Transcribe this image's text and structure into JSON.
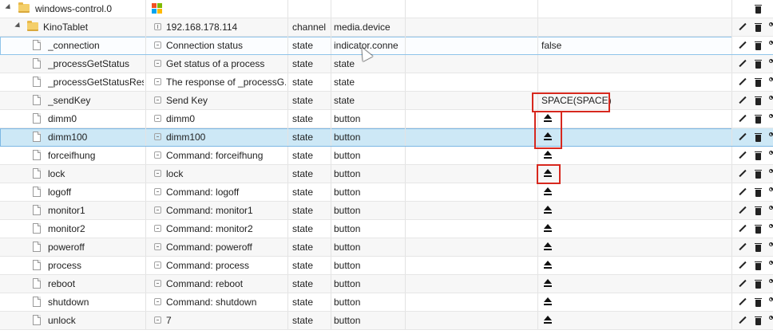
{
  "root": {
    "name": "windows-control.0"
  },
  "device": {
    "name": "KinoTablet",
    "ip": "192.168.178.114",
    "type": "channel",
    "role": "media.device"
  },
  "colors": {
    "selected_row": "#cde8f6",
    "highlight_box": "#d7281e",
    "folder": "#e8b84a"
  },
  "rows": [
    {
      "id": "_connection",
      "name": "Connection status",
      "type": "state",
      "role": "indicator.conne",
      "value": "false"
    },
    {
      "id": "_processGetStatus",
      "name": "Get status of a process",
      "type": "state",
      "role": "state",
      "value": ""
    },
    {
      "id": "_processGetStatusResul",
      "name": "The response of _processG...",
      "type": "state",
      "role": "state",
      "value": ""
    },
    {
      "id": "_sendKey",
      "name": "Send Key",
      "type": "state",
      "role": "state",
      "value": "SPACE(SPACE)"
    },
    {
      "id": "dimm0",
      "name": "dimm0",
      "type": "state",
      "role": "button",
      "value": ""
    },
    {
      "id": "dimm100",
      "name": "dimm100",
      "type": "state",
      "role": "button",
      "value": ""
    },
    {
      "id": "forceifhung",
      "name": "Command: forceifhung",
      "type": "state",
      "role": "button",
      "value": ""
    },
    {
      "id": "lock",
      "name": "lock",
      "type": "state",
      "role": "button",
      "value": ""
    },
    {
      "id": "logoff",
      "name": "Command: logoff",
      "type": "state",
      "role": "button",
      "value": ""
    },
    {
      "id": "monitor1",
      "name": "Command: monitor1",
      "type": "state",
      "role": "button",
      "value": ""
    },
    {
      "id": "monitor2",
      "name": "Command: monitor2",
      "type": "state",
      "role": "button",
      "value": ""
    },
    {
      "id": "poweroff",
      "name": "Command: poweroff",
      "type": "state",
      "role": "button",
      "value": ""
    },
    {
      "id": "process",
      "name": "Command: process",
      "type": "state",
      "role": "button",
      "value": ""
    },
    {
      "id": "reboot",
      "name": "Command: reboot",
      "type": "state",
      "role": "button",
      "value": ""
    },
    {
      "id": "shutdown",
      "name": "Command: shutdown",
      "type": "state",
      "role": "button",
      "value": ""
    },
    {
      "id": "unlock",
      "name": "7",
      "type": "state",
      "role": "button",
      "value": ""
    }
  ],
  "icons": {
    "eject": "eject-icon",
    "edit": "pencil-icon",
    "delete": "trash-icon",
    "settings": "wrench-icon"
  }
}
